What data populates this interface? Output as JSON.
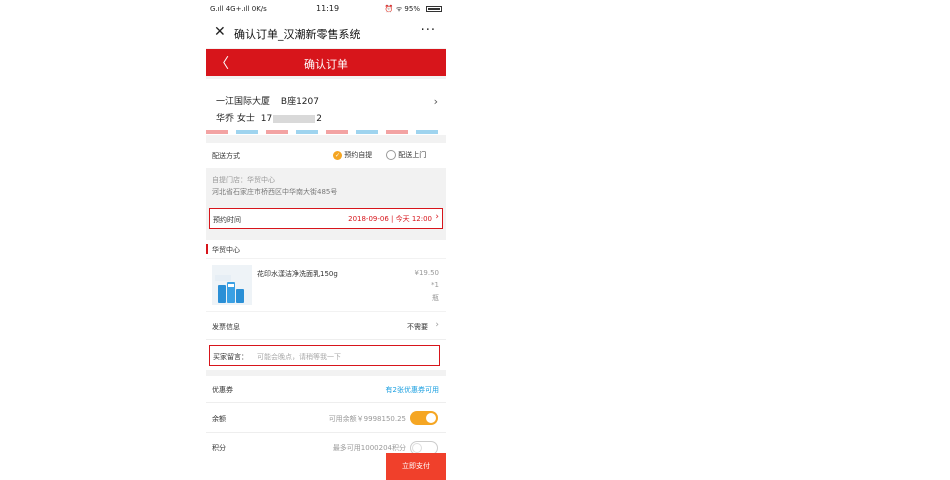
{
  "status_bar": {
    "left": "G.ıll 4G+.ıll 0K/s",
    "time": "11:19",
    "right": "⏰ ᯤ 95%"
  },
  "wechat_bar": {
    "close_icon": "✕",
    "title": "确认订单_汉潮新零售系统",
    "more": "···"
  },
  "nav": {
    "back_icon": "〈",
    "title": "确认订单"
  },
  "address": {
    "building": "一江国际大厦",
    "unit": "B座1207",
    "name": "华乔 女士",
    "phone_prefix": "17",
    "phone_suffix": "2",
    "arrow": "›"
  },
  "delivery": {
    "label": "配送方式",
    "options": [
      "预约自提",
      "配送上门"
    ],
    "selected": "预约自提"
  },
  "store": {
    "name": "自提门店：华贸中心",
    "address": "河北省石家庄市桥西区中华南大街485号"
  },
  "appointment": {
    "label": "预约时间",
    "value": "2018-09-06 | 今天 12:00",
    "arrow": "›"
  },
  "shop_name": "华贸中心",
  "product": {
    "name": "花印水漾洁净洗面乳150g",
    "price": "¥19.50",
    "qty": "*1",
    "unit": "瓶"
  },
  "invoice": {
    "label": "发票信息",
    "value": "不需要",
    "arrow": "›"
  },
  "message": {
    "label": "买家留言：",
    "placeholder": "可能会晚点，请稍等我一下"
  },
  "coupon": {
    "label": "优惠券",
    "value": "有2张优惠券可用"
  },
  "balance": {
    "label": "余额",
    "value": "可用余额￥9998150.25",
    "enabled": true
  },
  "points": {
    "label": "积分",
    "value": "最多可用1000204积分",
    "enabled": false
  },
  "pay_button": "立即支付",
  "colors": {
    "brand_red": "#d7151b",
    "pay_red": "#f0402b",
    "toggle_orange": "#f5a623",
    "coupon_blue": "#1a9fe0"
  }
}
